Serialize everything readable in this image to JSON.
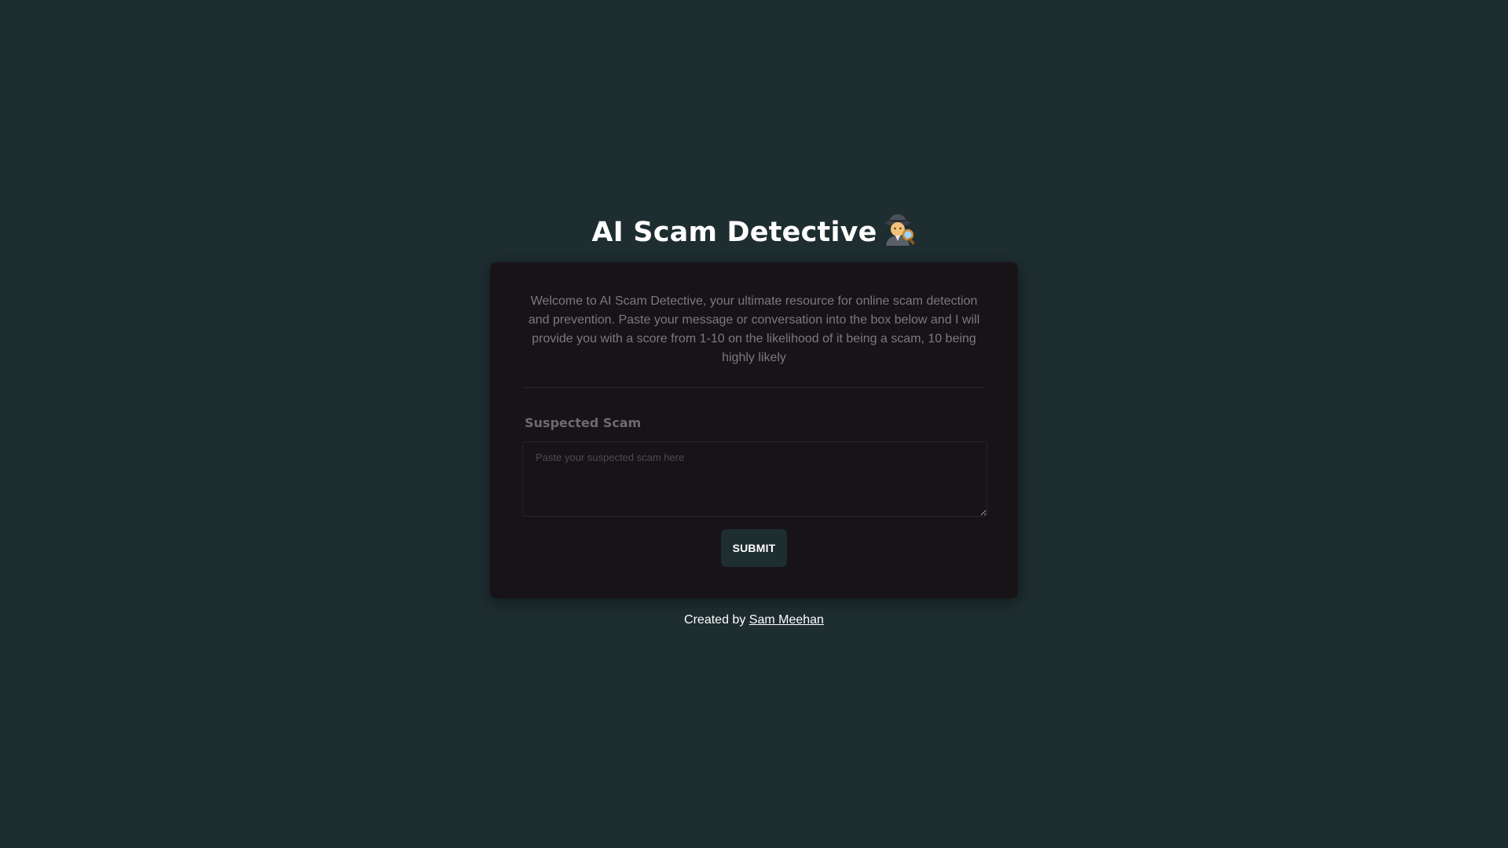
{
  "header": {
    "title": "AI Scam Detective",
    "title_icon": "detective-emoji-icon"
  },
  "card": {
    "intro": "Welcome to AI Scam Detective, your ultimate resource for online scam detection and prevention. Paste your message or conversation into the box below and I will provide you with a score from 1-10 on the likelihood of it being a scam, 10 being highly likely",
    "field_label": "Suspected Scam",
    "textarea_value": "",
    "textarea_placeholder": "Paste your suspected scam here",
    "submit_label": "SUBMIT"
  },
  "footer": {
    "prefix": "Created by",
    "author_link": "Sam Meehan"
  },
  "colors": {
    "page_background": "#1e2d30",
    "card_background": "#181317",
    "button_background": "#1e2d30",
    "text_muted": "#7c787b",
    "text_primary": "#ffffff"
  }
}
